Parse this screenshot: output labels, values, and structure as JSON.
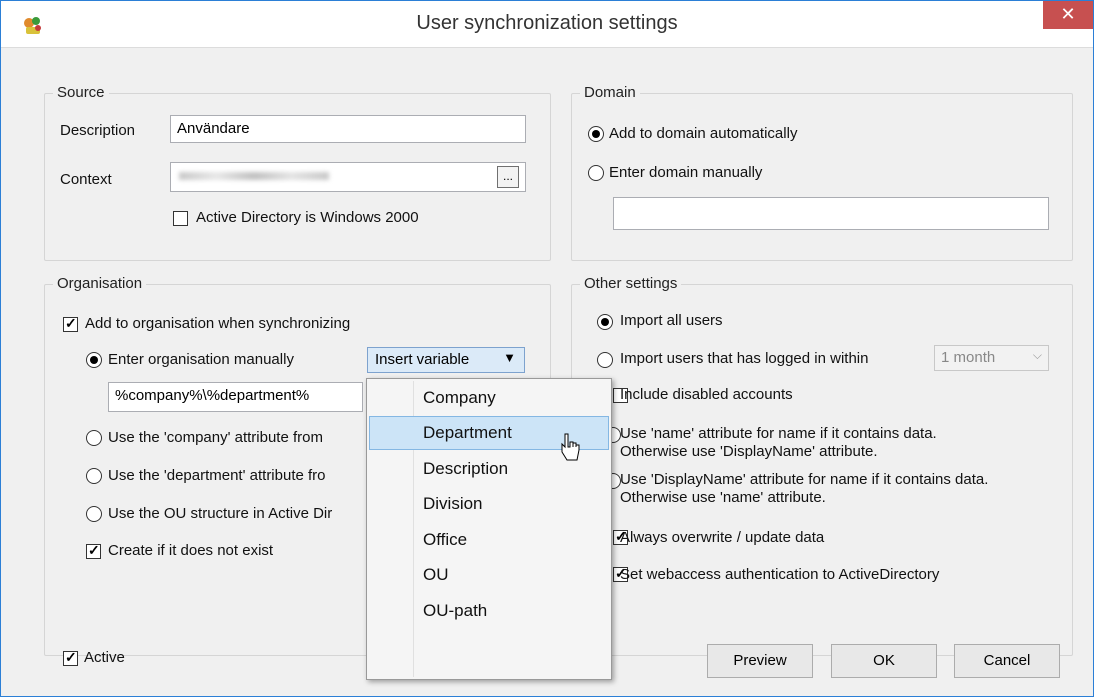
{
  "window": {
    "title": "User synchronization settings",
    "close_glyph": "✕"
  },
  "source": {
    "group_label": "Source",
    "description_label": "Description",
    "description_value": "Användare",
    "context_label": "Context",
    "context_value": "",
    "browse_label": "...",
    "ad_win2000_label": "Active Directory is Windows 2000",
    "ad_win2000_checked": false
  },
  "domain": {
    "group_label": "Domain",
    "auto_label": "Add to domain automatically",
    "manual_label": "Enter domain manually",
    "manual_value": ""
  },
  "organisation": {
    "group_label": "Organisation",
    "add_label": "Add to organisation when synchronizing",
    "manual_label": "Enter organisation manually",
    "insert_variable_label": "Insert variable",
    "org_value": "%company%\\%department%",
    "company_attr_label": "Use the 'company' attribute from",
    "department_attr_label": "Use the 'department' attribute fro",
    "ou_structure_label": "Use the OU structure in Active Dir",
    "create_label": "Create if it does not exist"
  },
  "other": {
    "group_label": "Other settings",
    "import_all_label": "Import all users",
    "import_logged_label": "Import users that has logged in within",
    "period_value": "1 month",
    "include_disabled_label": "Include disabled accounts",
    "name_attr_line1": "Use 'name' attribute for name if it contains data.",
    "name_attr_line2": "Otherwise use 'DisplayName' attribute.",
    "display_attr_line1": "Use 'DisplayName' attribute for name if it contains data.",
    "display_attr_line2": "Otherwise use 'name' attribute.",
    "overwrite_label": "Always overwrite / update data",
    "webaccess_label": "Set webaccess authentication to ActiveDirectory"
  },
  "footer": {
    "active_label": "Active",
    "preview_label": "Preview",
    "ok_label": "OK",
    "cancel_label": "Cancel"
  },
  "dropdown": {
    "items": [
      "Company",
      "Department",
      "Description",
      "Division",
      "Office",
      "OU",
      "OU-path"
    ],
    "highlighted": "Department"
  },
  "colors": {
    "accent": "#2b7fd6",
    "close": "#c75050",
    "highlight": "#cce4f7"
  }
}
